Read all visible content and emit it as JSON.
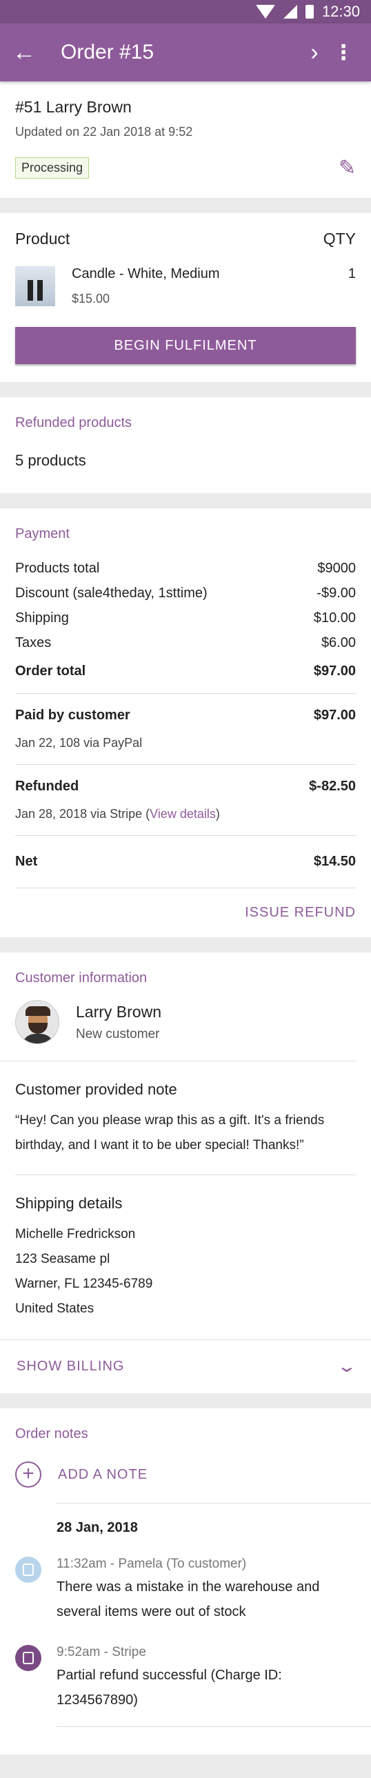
{
  "status_bar": {
    "time": "12:30"
  },
  "app_bar": {
    "title": "Order #15"
  },
  "summary": {
    "order_name": "#51 Larry Brown",
    "updated": "Updated on 22 Jan 2018 at 9:52",
    "status": "Processing"
  },
  "product": {
    "header_label": "Product",
    "header_qty": "QTY",
    "name": "Candle - White, Medium",
    "price": "$15.00",
    "qty": "1",
    "fulfil_button": "BEGIN FULFILMENT"
  },
  "refunded_products": {
    "title": "Refunded products",
    "count": "5 products"
  },
  "payment": {
    "title": "Payment",
    "lines": [
      {
        "label": "Products total",
        "value": "$9000"
      },
      {
        "label": "Discount (sale4theday, 1sttime)",
        "value": "-$9.00"
      },
      {
        "label": "Shipping",
        "value": "$10.00"
      },
      {
        "label": "Taxes",
        "value": "$6.00"
      }
    ],
    "order_total_label": "Order total",
    "order_total": "$97.00",
    "paid_label": "Paid by customer",
    "paid_value": "$97.00",
    "paid_sub": "Jan 22, 108 via PayPal",
    "refunded_label": "Refunded",
    "refunded_value": "$-82.50",
    "refunded_sub_prefix": "Jan 28, 2018 via Stripe (",
    "refunded_sub_link": "View details",
    "refunded_sub_suffix": ")",
    "net_label": "Net",
    "net_value": "$14.50",
    "issue_refund": "ISSUE REFUND"
  },
  "customer": {
    "title": "Customer information",
    "name": "Larry Brown",
    "type": "New customer",
    "note_title": "Customer provided note",
    "note_text": "“Hey! Can you please wrap this as a gift. It's a friends birthday, and I want it to be uber special! Thanks!”",
    "shipping_title": "Shipping details",
    "shipping_lines": [
      "Michelle Fredrickson",
      "123 Seasame pl",
      "Warner, FL 12345-6789",
      "United States"
    ],
    "show_billing": "SHOW BILLING"
  },
  "notes": {
    "title": "Order notes",
    "add_note": "ADD A NOTE",
    "date": "28 Jan, 2018",
    "items": [
      {
        "meta": "11:32am - Pamela (To customer)",
        "body": "There was a mistake in the warehouse and several items were out of stock"
      },
      {
        "meta": "9:52am - Stripe",
        "body": "Partial refund successful (Charge ID: 1234567890)"
      }
    ]
  },
  "colors": {
    "primary": "#8e5b9a",
    "status_bar": "#7a4f85",
    "badge_border": "#b6d98c"
  }
}
